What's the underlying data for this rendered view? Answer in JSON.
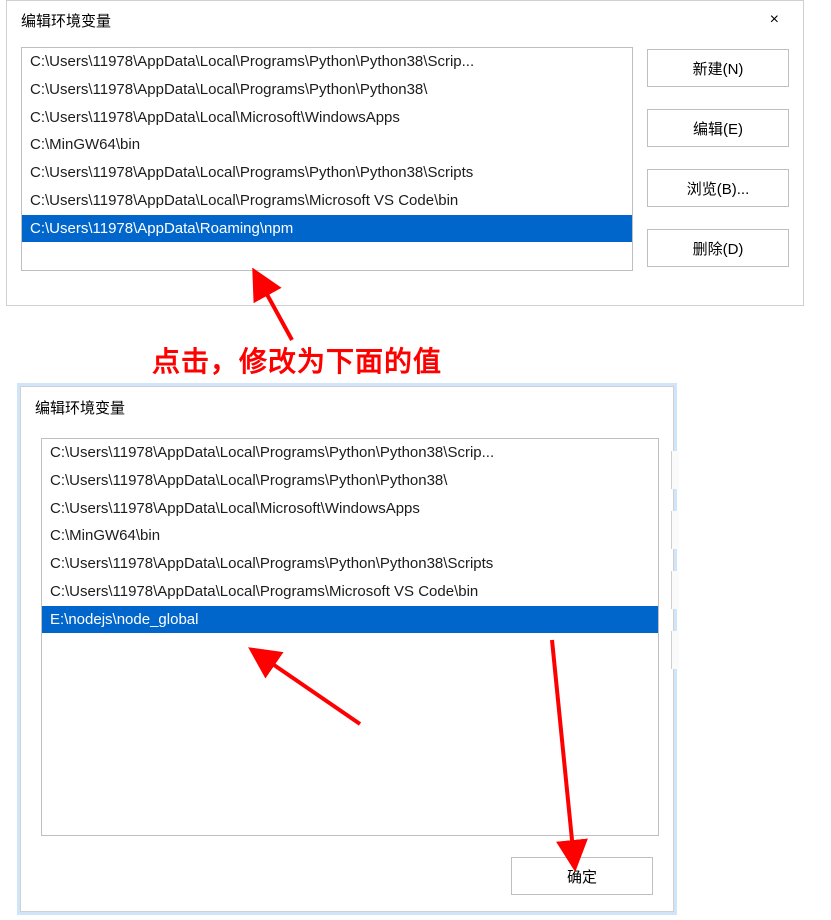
{
  "dialog1": {
    "title": "编辑环境变量",
    "close": "×",
    "list": [
      "C:\\Users\\11978\\AppData\\Local\\Programs\\Python\\Python38\\Scrip...",
      "C:\\Users\\11978\\AppData\\Local\\Programs\\Python\\Python38\\",
      "C:\\Users\\11978\\AppData\\Local\\Microsoft\\WindowsApps",
      "C:\\MinGW64\\bin",
      "C:\\Users\\11978\\AppData\\Local\\Programs\\Python\\Python38\\Scripts",
      "C:\\Users\\11978\\AppData\\Local\\Programs\\Microsoft VS Code\\bin",
      "C:\\Users\\11978\\AppData\\Roaming\\npm"
    ],
    "selected_index": 6,
    "buttons": {
      "new": "新建(N)",
      "edit": "编辑(E)",
      "browse": "浏览(B)...",
      "delete": "删除(D)"
    }
  },
  "annotation": "点击，修改为下面的值",
  "dialog2": {
    "title": "编辑环境变量",
    "list": [
      "C:\\Users\\11978\\AppData\\Local\\Programs\\Python\\Python38\\Scrip...",
      "C:\\Users\\11978\\AppData\\Local\\Programs\\Python\\Python38\\",
      "C:\\Users\\11978\\AppData\\Local\\Microsoft\\WindowsApps",
      "C:\\MinGW64\\bin",
      "C:\\Users\\11978\\AppData\\Local\\Programs\\Python\\Python38\\Scripts",
      "C:\\Users\\11978\\AppData\\Local\\Programs\\Microsoft VS Code\\bin",
      "E:\\nodejs\\node_global"
    ],
    "selected_index": 6,
    "ok": "确定"
  }
}
